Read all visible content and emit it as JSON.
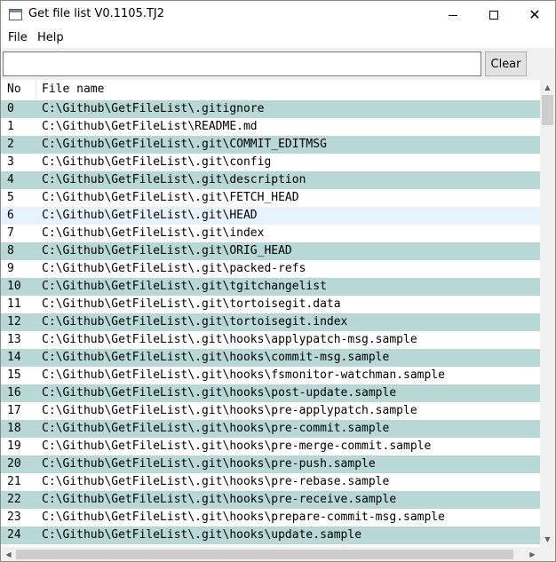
{
  "window": {
    "title": "Get file list V0.1105.TJ2",
    "icon": "app-window-icon"
  },
  "menu": {
    "file": "File",
    "help": "Help"
  },
  "toolbar": {
    "search_value": "",
    "search_placeholder": "",
    "clear_label": "Clear"
  },
  "table": {
    "columns": [
      "No",
      "File name"
    ],
    "rows": [
      {
        "no": "0",
        "name": "C:\\Github\\GetFileList\\.gitignore"
      },
      {
        "no": "1",
        "name": "C:\\Github\\GetFileList\\README.md"
      },
      {
        "no": "2",
        "name": "C:\\Github\\GetFileList\\.git\\COMMIT_EDITMSG"
      },
      {
        "no": "3",
        "name": "C:\\Github\\GetFileList\\.git\\config"
      },
      {
        "no": "4",
        "name": "C:\\Github\\GetFileList\\.git\\description"
      },
      {
        "no": "5",
        "name": "C:\\Github\\GetFileList\\.git\\FETCH_HEAD"
      },
      {
        "no": "6",
        "name": "C:\\Github\\GetFileList\\.git\\HEAD"
      },
      {
        "no": "7",
        "name": "C:\\Github\\GetFileList\\.git\\index"
      },
      {
        "no": "8",
        "name": "C:\\Github\\GetFileList\\.git\\ORIG_HEAD"
      },
      {
        "no": "9",
        "name": "C:\\Github\\GetFileList\\.git\\packed-refs"
      },
      {
        "no": "10",
        "name": "C:\\Github\\GetFileList\\.git\\tgitchangelist"
      },
      {
        "no": "11",
        "name": "C:\\Github\\GetFileList\\.git\\tortoisegit.data"
      },
      {
        "no": "12",
        "name": "C:\\Github\\GetFileList\\.git\\tortoisegit.index"
      },
      {
        "no": "13",
        "name": "C:\\Github\\GetFileList\\.git\\hooks\\applypatch-msg.sample"
      },
      {
        "no": "14",
        "name": "C:\\Github\\GetFileList\\.git\\hooks\\commit-msg.sample"
      },
      {
        "no": "15",
        "name": "C:\\Github\\GetFileList\\.git\\hooks\\fsmonitor-watchman.sample"
      },
      {
        "no": "16",
        "name": "C:\\Github\\GetFileList\\.git\\hooks\\post-update.sample"
      },
      {
        "no": "17",
        "name": "C:\\Github\\GetFileList\\.git\\hooks\\pre-applypatch.sample"
      },
      {
        "no": "18",
        "name": "C:\\Github\\GetFileList\\.git\\hooks\\pre-commit.sample"
      },
      {
        "no": "19",
        "name": "C:\\Github\\GetFileList\\.git\\hooks\\pre-merge-commit.sample"
      },
      {
        "no": "20",
        "name": "C:\\Github\\GetFileList\\.git\\hooks\\pre-push.sample"
      },
      {
        "no": "21",
        "name": "C:\\Github\\GetFileList\\.git\\hooks\\pre-rebase.sample"
      },
      {
        "no": "22",
        "name": "C:\\Github\\GetFileList\\.git\\hooks\\pre-receive.sample"
      },
      {
        "no": "23",
        "name": "C:\\Github\\GetFileList\\.git\\hooks\\prepare-commit-msg.sample"
      },
      {
        "no": "24",
        "name": "C:\\Github\\GetFileList\\.git\\hooks\\update.sample"
      }
    ]
  },
  "colors": {
    "alt_row": "#b8d8d8",
    "hover_row": "#e5f3ff"
  }
}
